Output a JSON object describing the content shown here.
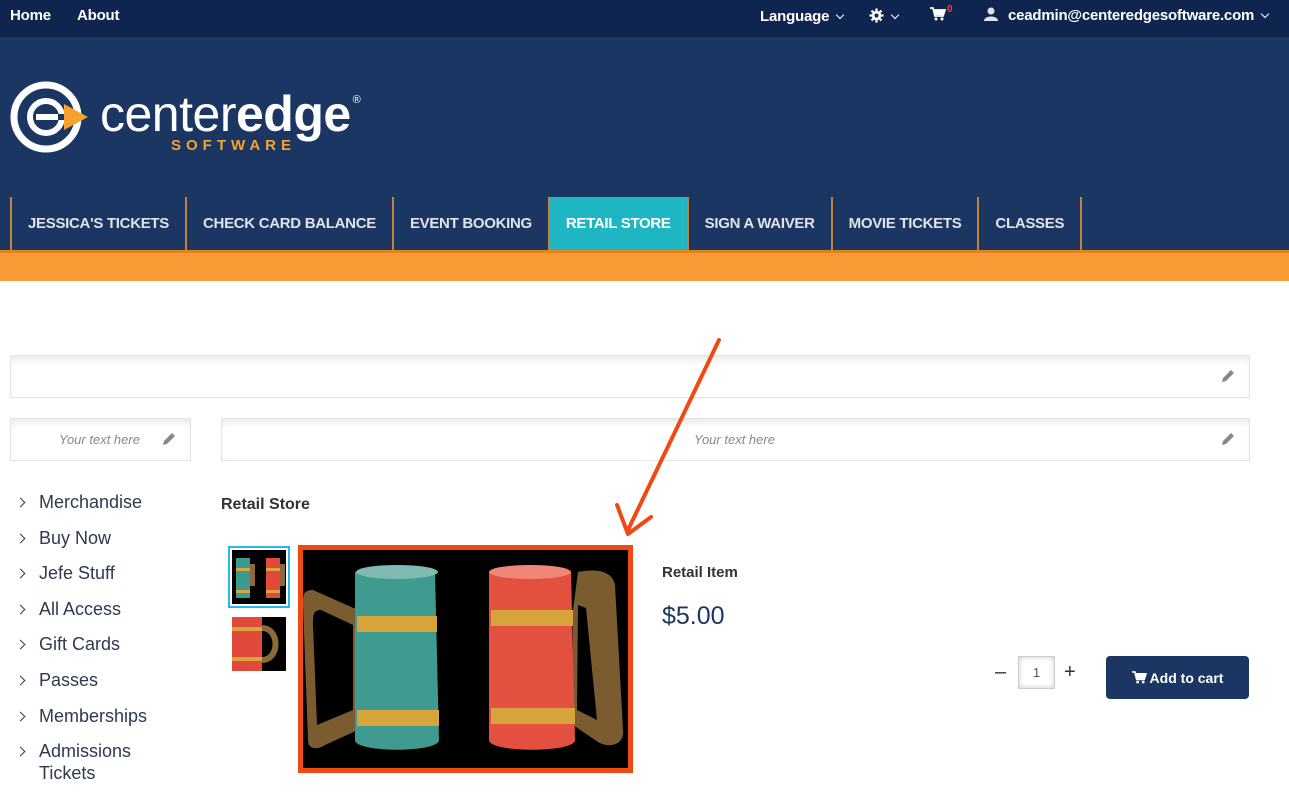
{
  "topbar": {
    "home": "Home",
    "about": "About",
    "language": "Language",
    "cart_count": "0",
    "user_email": "ceadmin@centeredgesoftware.com"
  },
  "brand": {
    "name_light": "center",
    "name_bold": "edge",
    "registered": "®",
    "subtitle": "SOFTWARE",
    "accent_color": "#f7a22c",
    "primary_color": "#1b3663"
  },
  "nav": {
    "items": [
      {
        "label": "JESSICA'S TICKETS"
      },
      {
        "label": "CHECK CARD BALANCE"
      },
      {
        "label": "EVENT BOOKING"
      },
      {
        "label": "RETAIL STORE"
      },
      {
        "label": "SIGN A WAIVER"
      },
      {
        "label": "MOVIE TICKETS"
      },
      {
        "label": "CLASSES"
      }
    ],
    "active_index": 3
  },
  "text_blocks": {
    "left_placeholder": "Your text here",
    "right_placeholder": "Your text here"
  },
  "sidebar": {
    "items": [
      {
        "label": "Merchandise"
      },
      {
        "label": "Buy Now"
      },
      {
        "label": "Jefe Stuff"
      },
      {
        "label": "All Access"
      },
      {
        "label": "Gift Cards"
      },
      {
        "label": "Passes"
      },
      {
        "label": "Memberships"
      },
      {
        "label": "Admissions"
      },
      {
        "label": "Tickets"
      }
    ]
  },
  "main": {
    "section_title": "Retail Store",
    "product": {
      "name": "Retail Item",
      "price": "$5.00",
      "quantity": "1",
      "minus_label": "–",
      "plus_label": "+",
      "add_to_cart_label": "Add to cart"
    }
  },
  "icons": [
    "gear-icon",
    "cart-icon",
    "user-icon",
    "chevron-down-icon",
    "pencil-icon",
    "chevron-right-icon"
  ]
}
